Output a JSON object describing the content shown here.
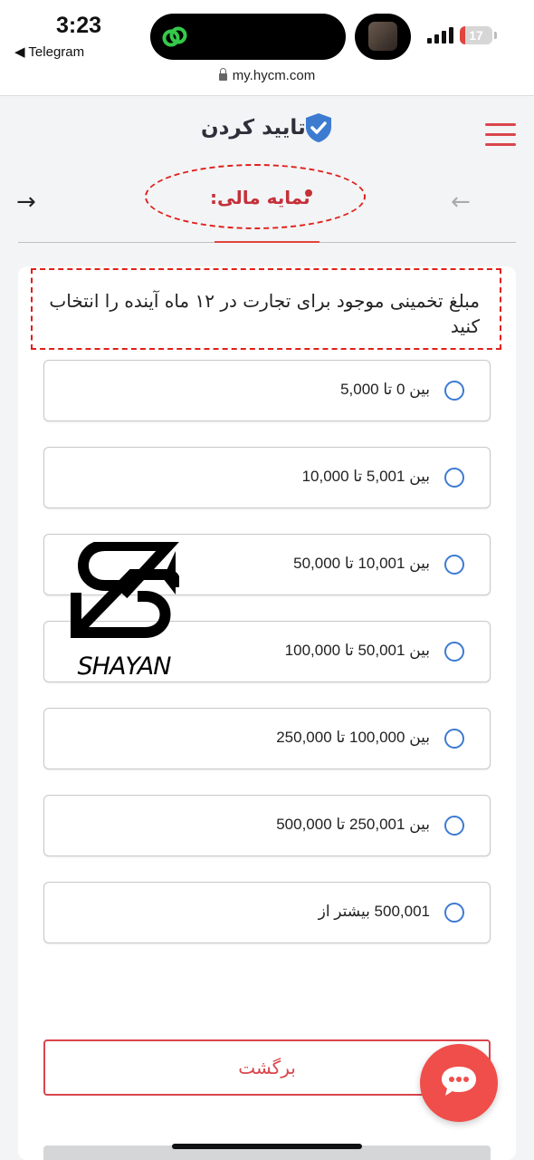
{
  "status_bar": {
    "time": "3:23",
    "back_app": "◀ Telegram",
    "battery_level": "17",
    "battery_percent": 0.17
  },
  "url_bar": {
    "url": "my.hycm.com"
  },
  "header": {
    "title": "تایید کردن",
    "shield_icon": "shield-check-icon",
    "menu_icon": "hamburger-menu-icon"
  },
  "step_nav": {
    "current_step": "نمایه مالی:",
    "next_icon": "arrow-right-icon",
    "prev_icon": "arrow-left-icon"
  },
  "question": "مبلغ تخمینی موجود برای تجارت در ۱۲ ماه آینده را انتخاب کنید",
  "options": [
    {
      "label": "بین 0 تا 5,000",
      "selected": false
    },
    {
      "label": "بین 5,001 تا 10,000",
      "selected": false
    },
    {
      "label": "بین 10,001 تا 50,000",
      "selected": false
    },
    {
      "label": "بین 50,001 تا 100,000",
      "selected": false
    },
    {
      "label": "بین 100,000 تا 250,000",
      "selected": false
    },
    {
      "label": "بین 250,001 تا 500,000",
      "selected": false
    },
    {
      "label": "500,001 بیشتر از",
      "selected": false
    }
  ],
  "watermark": "SHAYAN",
  "back_button": "برگشت",
  "chat_icon": "chat-bubble-icon",
  "colors": {
    "accent_red": "#d9464c",
    "radio_blue": "#3d7bd1",
    "annotation_red": "#e0201a"
  }
}
